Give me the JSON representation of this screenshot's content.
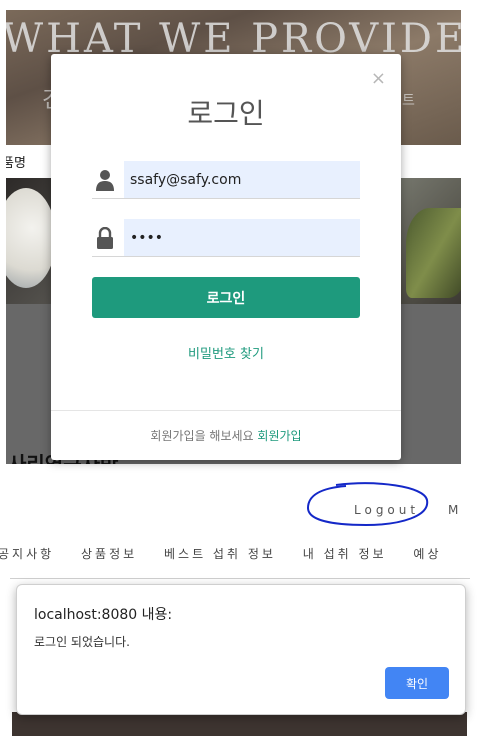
{
  "background": {
    "hero_title": "WHAT WE PROVIDE",
    "hero_subtitle": "건",
    "hero_subtitle_right": "트",
    "filter_label": "품명",
    "grey_heading": "사리연구자반"
  },
  "login_modal": {
    "close_label": "×",
    "title": "로그인",
    "email_value": "ssafy@safy.com",
    "password_value": "••••",
    "login_button": "로그인",
    "find_password": "비밀번호 찾기",
    "footer_text": "회원가입을 해보세요",
    "footer_link": "회원가입"
  },
  "header": {
    "logout_label": "Logout",
    "cut_label": "M"
  },
  "nav": {
    "items": [
      "공지사항",
      "상품정보",
      "베스트 섭취 정보",
      "내 섭취 정보",
      "예상"
    ]
  },
  "alert": {
    "title": "localhost:8080 내용:",
    "message": "로그인 되었습니다.",
    "ok_label": "확인"
  },
  "colors": {
    "accent_green": "#1e9a7d",
    "alert_button_blue": "#4285f4",
    "annotation_ring": "#1428c8"
  }
}
